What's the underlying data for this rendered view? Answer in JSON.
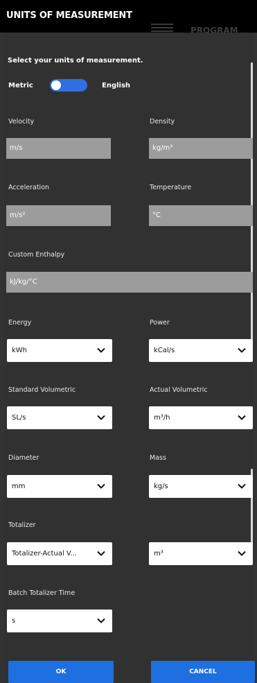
{
  "header": {
    "title": "UNITS OF MEASUREMENT",
    "background_label": "PROGRAM"
  },
  "form": {
    "instruction": "Select your units of measurement.",
    "toggle": {
      "left_label": "Metric",
      "right_label": "English",
      "state": "English"
    },
    "velocity": {
      "label": "Velocity",
      "value": "m/s"
    },
    "density": {
      "label": "Density",
      "value": "kg/m³"
    },
    "acceleration": {
      "label": "Acceleration",
      "value": "m/s²"
    },
    "temperature": {
      "label": "Temperature",
      "value": "°C"
    },
    "custom_enthalpy": {
      "label": "Custom Enthalpy",
      "value": "kJ/kg/°C"
    },
    "energy": {
      "label": "Energy",
      "value": "kWh"
    },
    "power": {
      "label": "Power",
      "value": "kCal/s"
    },
    "standard_volumetric": {
      "label": "Standard Volumetric",
      "value": "SL/s"
    },
    "actual_volumetric": {
      "label": "Actual Volumetric",
      "value": "m³/h"
    },
    "diameter": {
      "label": "Diameter",
      "value": "mm"
    },
    "mass": {
      "label": "Mass",
      "value": "kg/s"
    },
    "totalizer": {
      "label": "Totalizer",
      "value": "Totalizer-Actual V...",
      "unit": "m³"
    },
    "batch_totalizer_time": {
      "label": "Batch Totalizer Time",
      "value": "s"
    }
  },
  "buttons": {
    "ok": "OK",
    "cancel": "CANCEL"
  },
  "colors": {
    "accent": "#1e6fe0",
    "background": "#333333",
    "readonly_field": "#9c9c9c",
    "header": "#000000"
  },
  "icons": {
    "dropdown": "chevron-down-icon"
  }
}
